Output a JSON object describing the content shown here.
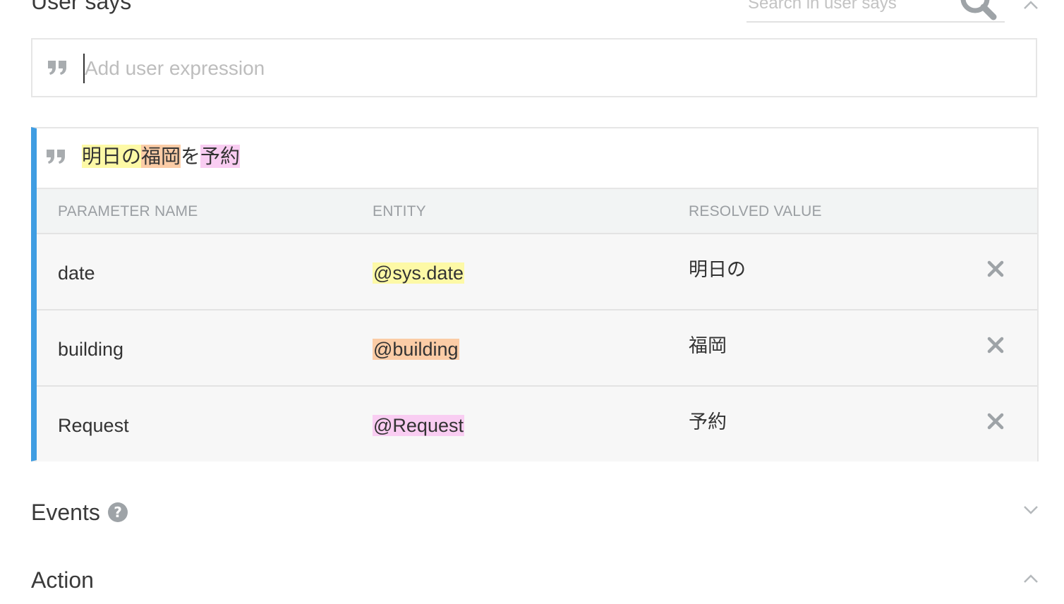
{
  "user_says": {
    "title": "User says",
    "search_placeholder": "Search in user says",
    "expression_placeholder": "Add user expression"
  },
  "phrase": {
    "segments": [
      {
        "text": "明日の",
        "highlight": "#fdf9a6"
      },
      {
        "text": "福岡",
        "highlight": "#fbcca6"
      },
      {
        "text": "を",
        "highlight": ""
      },
      {
        "text": "予約",
        "highlight": "#f9cdf2"
      }
    ]
  },
  "params_table": {
    "headers": [
      "PARAMETER NAME",
      "ENTITY",
      "RESOLVED VALUE"
    ],
    "rows": [
      {
        "name": "date",
        "entity": "@sys.date",
        "entity_color": "#fdf9a6",
        "value": "明日の"
      },
      {
        "name": "building",
        "entity": "@building",
        "entity_color": "#fbcca6",
        "value": "福岡"
      },
      {
        "name": "Request",
        "entity": "@Request",
        "entity_color": "#f9cdf2",
        "value": "予約"
      }
    ]
  },
  "events": {
    "title": "Events"
  },
  "action": {
    "title": "Action"
  },
  "colors": {
    "accent": "#3f9de2",
    "icon_gray": "#9ea3a7"
  },
  "icons": {
    "search": "search-icon",
    "quote": "quote-icon",
    "remove": "close-icon",
    "help": "help-icon",
    "chevron_up": "chevron-up-icon",
    "chevron_down": "chevron-down-icon"
  }
}
